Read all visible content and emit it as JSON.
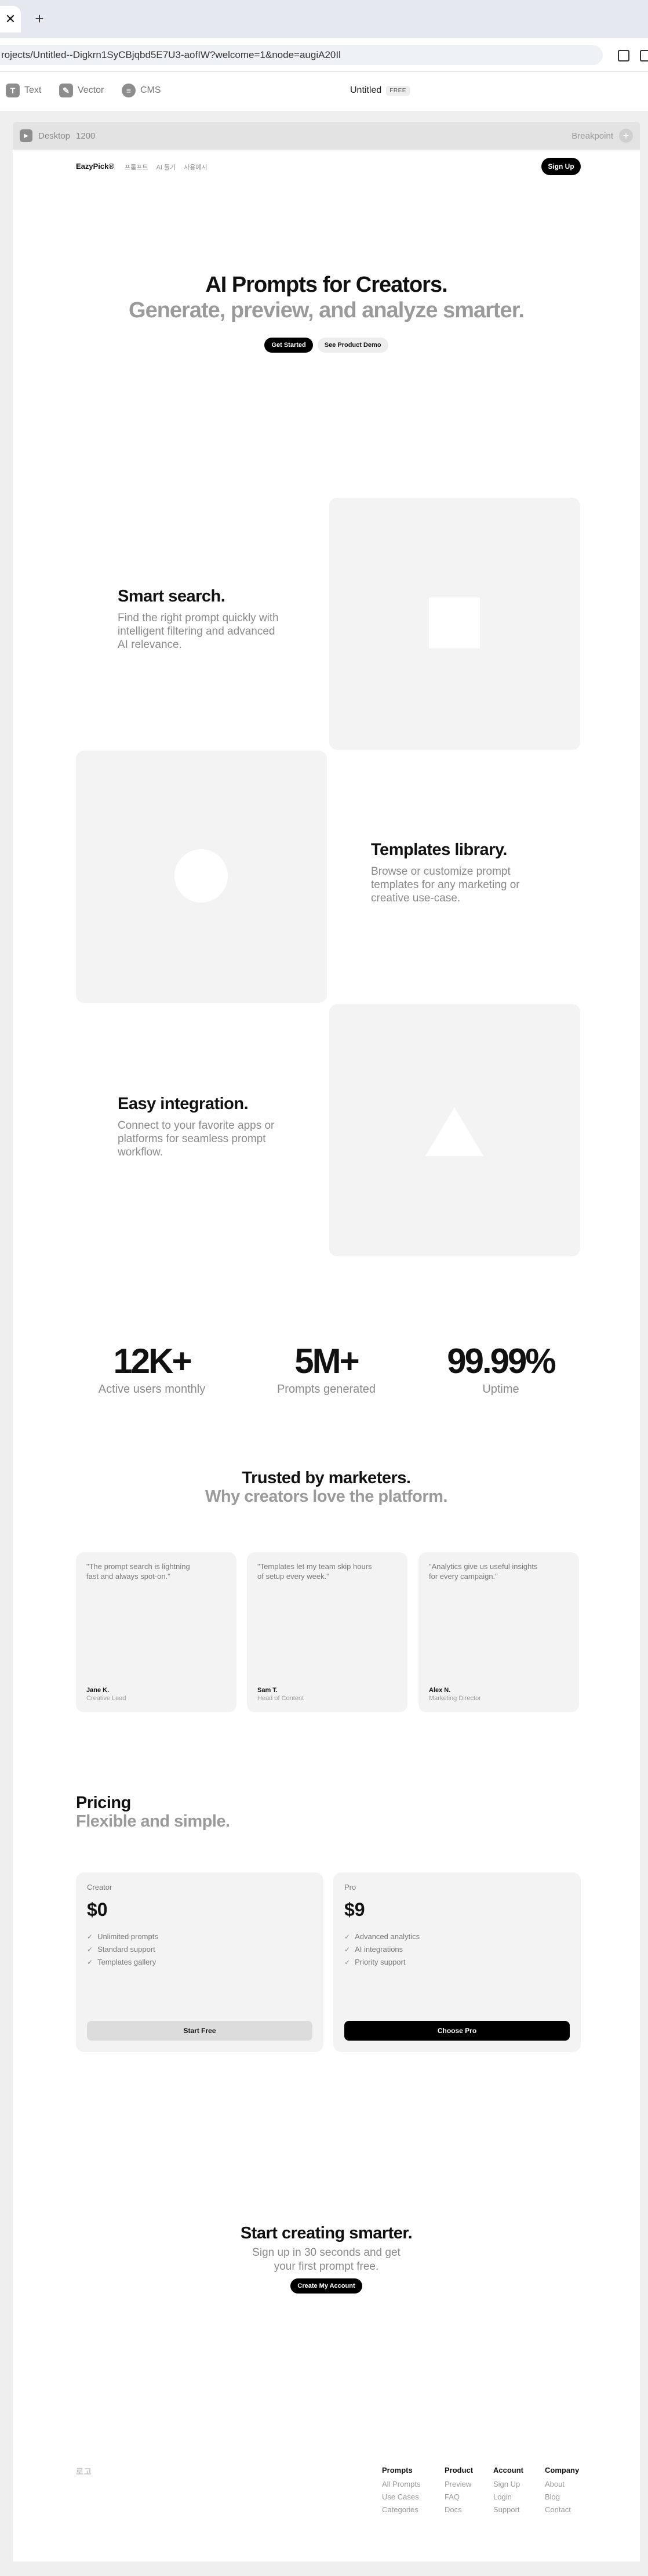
{
  "browser": {
    "tab_close": "✕",
    "new_tab": "+",
    "url": "rojects/Untitled--Digkrn1SyCBjqbd5E7U3-aofIW?welcome=1&node=augiA20Il"
  },
  "editor": {
    "tools": [
      {
        "icon": "T",
        "label": "Text"
      },
      {
        "icon": "✎",
        "label": "Vector"
      },
      {
        "icon": "≡",
        "label": "CMS"
      }
    ],
    "doc_name": "Untitled",
    "doc_badge": "FREE",
    "frame_label": "Desktop",
    "frame_width": "1200",
    "breakpoint_label": "Breakpoint",
    "breakpoint_add": "+"
  },
  "site": {
    "logo": "EazyPick®",
    "nav_links": [
      "프롬프트",
      "AI 툴기",
      "사용예시"
    ],
    "signup": "Sign Up",
    "hero": {
      "title": "AI Prompts for Creators.",
      "subtitle": "Generate, preview, and analyze smarter.",
      "primary_btn": "Get Started",
      "secondary_btn": "See Product Demo"
    },
    "features": [
      {
        "title": "Smart search.",
        "desc": "Find the right prompt quickly with intelligent filtering and advanced AI relevance."
      },
      {
        "title": "Templates library.",
        "desc": "Browse or customize prompt templates for any marketing or creative use-case."
      },
      {
        "title": "Easy integration.",
        "desc": "Connect to your favorite apps or platforms for seamless prompt workflow."
      }
    ],
    "stats": [
      {
        "value": "12K+",
        "label": "Active users monthly"
      },
      {
        "value": "5M+",
        "label": "Prompts generated"
      },
      {
        "value": "99.99%",
        "label": "Uptime"
      }
    ],
    "testimonials": {
      "title": "Trusted by marketers.",
      "subtitle": "Why creators love the platform.",
      "items": [
        {
          "quote": "\"The prompt search is lightning fast and always spot-on.\"",
          "name": "Jane K.",
          "role": "Creative Lead"
        },
        {
          "quote": "\"Templates let my team skip hours of setup every week.\"",
          "name": "Sam T.",
          "role": "Head of Content"
        },
        {
          "quote": "\"Analytics give us useful insights for every campaign.\"",
          "name": "Alex N.",
          "role": "Marketing Director"
        }
      ]
    },
    "pricing": {
      "title": "Pricing",
      "subtitle": "Flexible and simple.",
      "plans": [
        {
          "name": "Creator",
          "price": "$0",
          "features": [
            "Unlimited prompts",
            "Standard support",
            "Templates gallery"
          ],
          "button": "Start Free"
        },
        {
          "name": "Pro",
          "price": "$9",
          "features": [
            "Advanced analytics",
            "AI integrations",
            "Priority support"
          ],
          "button": "Choose Pro"
        }
      ]
    },
    "cta": {
      "title": "Start creating smarter.",
      "desc": "Sign up in 30 seconds and get your first prompt free.",
      "button": "Create My Account"
    },
    "footer": {
      "logo": "로고",
      "columns": [
        {
          "title": "Prompts",
          "links": [
            "All Prompts",
            "Use Cases",
            "Categories"
          ]
        },
        {
          "title": "Product",
          "links": [
            "Preview",
            "FAQ",
            "Docs"
          ]
        },
        {
          "title": "Account",
          "links": [
            "Sign Up",
            "Login",
            "Support"
          ]
        },
        {
          "title": "Company",
          "links": [
            "About",
            "Blog",
            "Contact"
          ]
        }
      ]
    }
  }
}
